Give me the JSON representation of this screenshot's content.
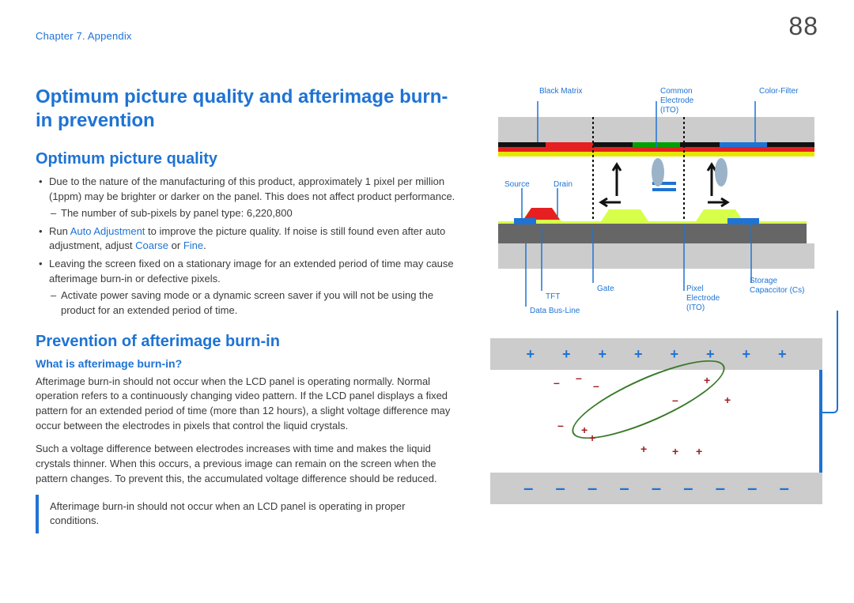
{
  "chapter": "Chapter 7. Appendix",
  "page": "88",
  "title": "Optimum picture quality and afterimage burn-in prevention",
  "sec1": {
    "heading": "Optimum picture quality",
    "b1a": "Due to the nature of the manufacturing of this product, approximately 1 pixel per million (1ppm) may be brighter or darker on the panel. This does not affect product performance.",
    "b1d": "The number of sub-pixels by panel type: 6,220,800",
    "b2a": "Run ",
    "b2link1": "Auto Adjustment",
    "b2b": " to improve the picture quality. If noise is still found even after auto adjustment, adjust ",
    "b2link2": "Coarse",
    "b2c": " or ",
    "b2link3": "Fine",
    "b2d": ".",
    "b3": "Leaving the screen fixed on a stationary image for an extended period of time may cause afterimage burn-in or defective pixels.",
    "b3d": "Activate power saving mode or a dynamic screen saver if you will not be using the product for an extended period of time."
  },
  "sec2": {
    "heading": "Prevention of afterimage burn-in",
    "sub": "What is afterimage burn-in?",
    "p1": "Afterimage burn-in should not occur when the LCD panel is operating normally. Normal operation refers to a continuously changing video pattern. If the LCD panel displays a fixed pattern for an extended period of time (more than 12 hours), a slight voltage difference may occur between the electrodes in pixels that control the liquid crystals.",
    "p2": "Such a voltage difference between electrodes increases with time and makes the liquid crystals thinner. When this occurs, a previous image can remain on the screen when the pattern changes. To prevent this, the accumulated voltage difference should be reduced.",
    "note": "Afterimage burn-in should not occur when an LCD panel is operating in proper conditions."
  },
  "labels": {
    "blackmatrix": "Black Matrix",
    "common1": "Common",
    "common2": "Electrode",
    "common3": "(ITO)",
    "colorfilter": "Color-Filter",
    "source": "Source",
    "drain": "Drain",
    "tft": "TFT",
    "gate": "Gate",
    "databus": "Data Bus-Line",
    "pixel1": "Pixel",
    "pixel2": "Electrode",
    "pixel3": "(ITO)",
    "storage1": "Storage",
    "storage2": "Capaccitor (Cs)"
  }
}
